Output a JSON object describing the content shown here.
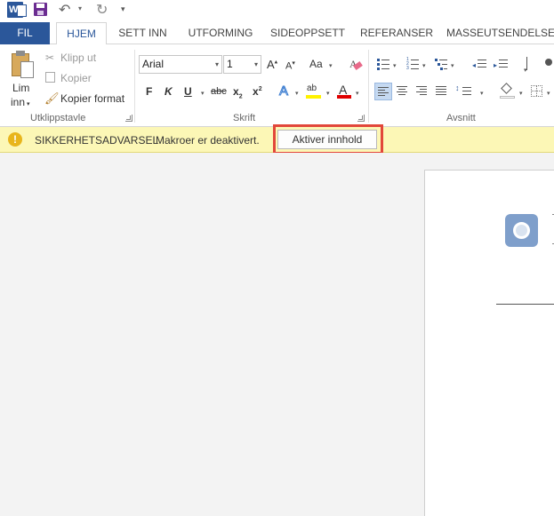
{
  "app": {
    "name": "Word"
  },
  "quick_access": {
    "icons": [
      "word-logo-icon",
      "save-icon",
      "undo-icon",
      "redo-icon",
      "customize-qat-icon"
    ]
  },
  "tabs": [
    {
      "label": "FIL",
      "kind": "file"
    },
    {
      "label": "HJEM",
      "active": true
    },
    {
      "label": "SETT INN"
    },
    {
      "label": "UTFORMING"
    },
    {
      "label": "SIDEOPPSETT"
    },
    {
      "label": "REFERANSER"
    },
    {
      "label": "MASSEUTSENDELSER"
    }
  ],
  "ribbon": {
    "clipboard": {
      "group_label": "Utklippstavle",
      "paste_label_line1": "Lim",
      "paste_label_line2": "inn",
      "cut_label": "Klipp ut",
      "copy_label": "Kopier",
      "format_painter_label": "Kopier format"
    },
    "font": {
      "group_label": "Skrift",
      "font_name": "Arial",
      "font_size": "1",
      "grow_label": "A",
      "shrink_label": "A",
      "case_label": "Aa",
      "bold": "F",
      "italic": "K",
      "underline": "U",
      "strikethrough": "abc",
      "subscript": "x",
      "superscript": "x",
      "text_effects": "A",
      "highlight": "ab",
      "font_color": "A"
    },
    "paragraph": {
      "group_label": "Avsnitt"
    }
  },
  "message_bar": {
    "title": "SIKKERHETSADVARSEL",
    "text": "Makroer er deaktivert.",
    "button_label": "Aktiver innhold"
  },
  "colors": {
    "accent": "#2b579a",
    "message_bar": "#fcf7b6",
    "highlight_border": "#e2473a",
    "warning": "#e8b51c"
  }
}
